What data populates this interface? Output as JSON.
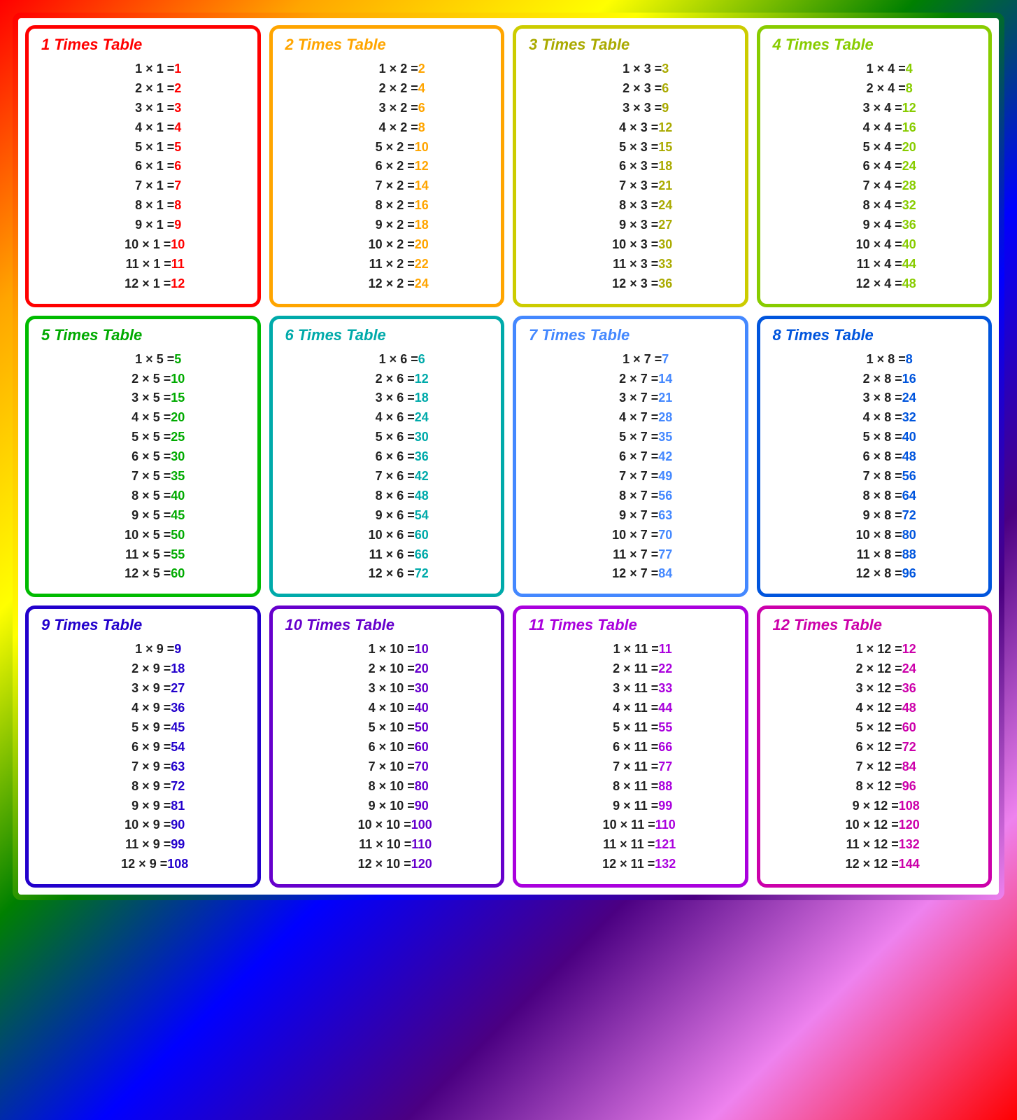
{
  "tables": [
    {
      "id": 1,
      "multiplier": 1,
      "title": "1 Times Table",
      "border": "red",
      "titleColor": "red",
      "resultColor": "red",
      "rows": [
        {
          "left": "1 × 1 =",
          "result": "1"
        },
        {
          "left": "2 × 1 =",
          "result": "2"
        },
        {
          "left": "3 × 1 =",
          "result": "3"
        },
        {
          "left": "4 × 1 =",
          "result": "4"
        },
        {
          "left": "5 × 1 =",
          "result": "5"
        },
        {
          "left": "6 × 1 =",
          "result": "6"
        },
        {
          "left": "7 × 1 =",
          "result": "7"
        },
        {
          "left": "8 × 1 =",
          "result": "8"
        },
        {
          "left": "9 × 1 =",
          "result": "9"
        },
        {
          "left": "10 × 1 =",
          "result": "10"
        },
        {
          "left": "11 × 1 =",
          "result": "11"
        },
        {
          "left": "12 × 1 =",
          "result": "12"
        }
      ]
    },
    {
      "id": 2,
      "multiplier": 2,
      "title": "2 Times Table",
      "border": "orange",
      "titleColor": "orange",
      "resultColor": "orange",
      "rows": [
        {
          "left": "1 × 2 =",
          "result": "2"
        },
        {
          "left": "2 × 2 =",
          "result": "4"
        },
        {
          "left": "3 × 2 =",
          "result": "6"
        },
        {
          "left": "4 × 2 =",
          "result": "8"
        },
        {
          "left": "5 × 2 =",
          "result": "10"
        },
        {
          "left": "6 × 2 =",
          "result": "12"
        },
        {
          "left": "7 × 2 =",
          "result": "14"
        },
        {
          "left": "8 × 2 =",
          "result": "16"
        },
        {
          "left": "9 × 2 =",
          "result": "18"
        },
        {
          "left": "10 × 2 =",
          "result": "20"
        },
        {
          "left": "11 × 2 =",
          "result": "22"
        },
        {
          "left": "12 × 2 =",
          "result": "24"
        }
      ]
    },
    {
      "id": 3,
      "multiplier": 3,
      "title": "3 Times Table",
      "border": "yellow",
      "titleColor": "yellow",
      "resultColor": "yellow",
      "rows": [
        {
          "left": "1 × 3 =",
          "result": "3"
        },
        {
          "left": "2 × 3 =",
          "result": "6"
        },
        {
          "left": "3 × 3 =",
          "result": "9"
        },
        {
          "left": "4 × 3 =",
          "result": "12"
        },
        {
          "left": "5 × 3 =",
          "result": "15"
        },
        {
          "left": "6 × 3 =",
          "result": "18"
        },
        {
          "left": "7 × 3 =",
          "result": "21"
        },
        {
          "left": "8 × 3 =",
          "result": "24"
        },
        {
          "left": "9 × 3 =",
          "result": "27"
        },
        {
          "left": "10 × 3 =",
          "result": "30"
        },
        {
          "left": "11 × 3 =",
          "result": "33"
        },
        {
          "left": "12 × 3 =",
          "result": "36"
        }
      ]
    },
    {
      "id": 4,
      "multiplier": 4,
      "title": "4 Times Table",
      "border": "green-light",
      "titleColor": "green-light",
      "resultColor": "green-light",
      "rows": [
        {
          "left": "1 × 4 =",
          "result": "4"
        },
        {
          "left": "2 × 4 =",
          "result": "8"
        },
        {
          "left": "3 × 4 =",
          "result": "12"
        },
        {
          "left": "4 × 4 =",
          "result": "16"
        },
        {
          "left": "5 × 4 =",
          "result": "20"
        },
        {
          "left": "6 × 4 =",
          "result": "24"
        },
        {
          "left": "7 × 4 =",
          "result": "28"
        },
        {
          "left": "8 × 4 =",
          "result": "32"
        },
        {
          "left": "9 × 4 =",
          "result": "36"
        },
        {
          "left": "10 × 4 =",
          "result": "40"
        },
        {
          "left": "11 × 4 =",
          "result": "44"
        },
        {
          "left": "12 × 4 =",
          "result": "48"
        }
      ]
    },
    {
      "id": 5,
      "multiplier": 5,
      "title": "5 Times Table",
      "border": "green",
      "titleColor": "green",
      "resultColor": "green",
      "rows": [
        {
          "left": "1 × 5 =",
          "result": "5"
        },
        {
          "left": "2 × 5 =",
          "result": "10"
        },
        {
          "left": "3 × 5 =",
          "result": "15"
        },
        {
          "left": "4 × 5 =",
          "result": "20"
        },
        {
          "left": "5 × 5 =",
          "result": "25"
        },
        {
          "left": "6 × 5 =",
          "result": "30"
        },
        {
          "left": "7 × 5 =",
          "result": "35"
        },
        {
          "left": "8 × 5 =",
          "result": "40"
        },
        {
          "left": "9 × 5 =",
          "result": "45"
        },
        {
          "left": "10 × 5 =",
          "result": "50"
        },
        {
          "left": "11 × 5 =",
          "result": "55"
        },
        {
          "left": "12 × 5 =",
          "result": "60"
        }
      ]
    },
    {
      "id": 6,
      "multiplier": 6,
      "title": "6 Times Table",
      "border": "teal",
      "titleColor": "teal",
      "resultColor": "teal",
      "rows": [
        {
          "left": "1 × 6 =",
          "result": "6"
        },
        {
          "left": "2 × 6 =",
          "result": "12"
        },
        {
          "left": "3 × 6 =",
          "result": "18"
        },
        {
          "left": "4 × 6 =",
          "result": "24"
        },
        {
          "left": "5 × 6 =",
          "result": "30"
        },
        {
          "left": "6 × 6 =",
          "result": "36"
        },
        {
          "left": "7 × 6 =",
          "result": "42"
        },
        {
          "left": "8 × 6 =",
          "result": "48"
        },
        {
          "left": "9 × 6 =",
          "result": "54"
        },
        {
          "left": "10 × 6 =",
          "result": "60"
        },
        {
          "left": "11 × 6 =",
          "result": "66"
        },
        {
          "left": "12 × 6 =",
          "result": "72"
        }
      ]
    },
    {
      "id": 7,
      "multiplier": 7,
      "title": "7 Times Table",
      "border": "blue-light",
      "titleColor": "blue-light",
      "resultColor": "blue-light",
      "rows": [
        {
          "left": "1 × 7 =",
          "result": "7"
        },
        {
          "left": "2 × 7 =",
          "result": "14"
        },
        {
          "left": "3 × 7 =",
          "result": "21"
        },
        {
          "left": "4 × 7 =",
          "result": "28"
        },
        {
          "left": "5 × 7 =",
          "result": "35"
        },
        {
          "left": "6 × 7 =",
          "result": "42"
        },
        {
          "left": "7 × 7 =",
          "result": "49"
        },
        {
          "left": "8 × 7 =",
          "result": "56"
        },
        {
          "left": "9 × 7 =",
          "result": "63"
        },
        {
          "left": "10 × 7 =",
          "result": "70"
        },
        {
          "left": "11 × 7 =",
          "result": "77"
        },
        {
          "left": "12 × 7 =",
          "result": "84"
        }
      ]
    },
    {
      "id": 8,
      "multiplier": 8,
      "title": "8 Times Table",
      "border": "blue",
      "titleColor": "blue",
      "resultColor": "blue",
      "rows": [
        {
          "left": "1 × 8 =",
          "result": "8"
        },
        {
          "left": "2 × 8 =",
          "result": "16"
        },
        {
          "left": "3 × 8 =",
          "result": "24"
        },
        {
          "left": "4 × 8 =",
          "result": "32"
        },
        {
          "left": "5 × 8 =",
          "result": "40"
        },
        {
          "left": "6 × 8 =",
          "result": "48"
        },
        {
          "left": "7 × 8 =",
          "result": "56"
        },
        {
          "left": "8 × 8 =",
          "result": "64"
        },
        {
          "left": "9 × 8 =",
          "result": "72"
        },
        {
          "left": "10 × 8 =",
          "result": "80"
        },
        {
          "left": "11 × 8 =",
          "result": "88"
        },
        {
          "left": "12 × 8 =",
          "result": "96"
        }
      ]
    },
    {
      "id": 9,
      "multiplier": 9,
      "title": "9 Times Table",
      "border": "blue-dark",
      "titleColor": "blue-dark",
      "resultColor": "blue-dark",
      "rows": [
        {
          "left": "1 × 9 =",
          "result": "9"
        },
        {
          "left": "2 × 9 =",
          "result": "18"
        },
        {
          "left": "3 × 9 =",
          "result": "27"
        },
        {
          "left": "4 × 9 =",
          "result": "36"
        },
        {
          "left": "5 × 9 =",
          "result": "45"
        },
        {
          "left": "6 × 9 =",
          "result": "54"
        },
        {
          "left": "7 × 9 =",
          "result": "63"
        },
        {
          "left": "8 × 9 =",
          "result": "72"
        },
        {
          "left": "9 × 9 =",
          "result": "81"
        },
        {
          "left": "10 × 9 =",
          "result": "90"
        },
        {
          "left": "11 × 9 =",
          "result": "99"
        },
        {
          "left": "12 × 9 =",
          "result": "108"
        }
      ]
    },
    {
      "id": 10,
      "multiplier": 10,
      "title": "10 Times Table",
      "border": "purple",
      "titleColor": "purple",
      "resultColor": "purple",
      "rows": [
        {
          "left": "1 × 10 =",
          "result": "10"
        },
        {
          "left": "2 × 10 =",
          "result": "20"
        },
        {
          "left": "3 × 10 =",
          "result": "30"
        },
        {
          "left": "4 × 10 =",
          "result": "40"
        },
        {
          "left": "5 × 10 =",
          "result": "50"
        },
        {
          "left": "6 × 10 =",
          "result": "60"
        },
        {
          "left": "7 × 10 =",
          "result": "70"
        },
        {
          "left": "8 × 10 =",
          "result": "80"
        },
        {
          "left": "9 × 10 =",
          "result": "90"
        },
        {
          "left": "10 × 10 =",
          "result": "100"
        },
        {
          "left": "11 × 10 =",
          "result": "110"
        },
        {
          "left": "12 × 10 =",
          "result": "120"
        }
      ]
    },
    {
      "id": 11,
      "multiplier": 11,
      "title": "11 Times Table",
      "border": "violet",
      "titleColor": "violet",
      "resultColor": "violet",
      "rows": [
        {
          "left": "1 × 11 =",
          "result": "11"
        },
        {
          "left": "2 × 11 =",
          "result": "22"
        },
        {
          "left": "3 × 11 =",
          "result": "33"
        },
        {
          "left": "4 × 11 =",
          "result": "44"
        },
        {
          "left": "5 × 11 =",
          "result": "55"
        },
        {
          "left": "6 × 11 =",
          "result": "66"
        },
        {
          "left": "7 × 11 =",
          "result": "77"
        },
        {
          "left": "8 × 11 =",
          "result": "88"
        },
        {
          "left": "9 × 11 =",
          "result": "99"
        },
        {
          "left": "10 × 11 =",
          "result": "110"
        },
        {
          "left": "11 × 11 =",
          "result": "121"
        },
        {
          "left": "12 × 11 =",
          "result": "132"
        }
      ]
    },
    {
      "id": 12,
      "multiplier": 12,
      "title": "12 Times Table",
      "border": "magenta",
      "titleColor": "magenta",
      "resultColor": "magenta",
      "rows": [
        {
          "left": "1 × 12 =",
          "result": "12"
        },
        {
          "left": "2 × 12 =",
          "result": "24"
        },
        {
          "left": "3 × 12 =",
          "result": "36"
        },
        {
          "left": "4 × 12 =",
          "result": "48"
        },
        {
          "left": "5 × 12 =",
          "result": "60"
        },
        {
          "left": "6 × 12 =",
          "result": "72"
        },
        {
          "left": "7 × 12 =",
          "result": "84"
        },
        {
          "left": "8 × 12 =",
          "result": "96"
        },
        {
          "left": "9 × 12 =",
          "result": "108"
        },
        {
          "left": "10 × 12 =",
          "result": "120"
        },
        {
          "left": "11 × 12 =",
          "result": "132"
        },
        {
          "left": "12 × 12 =",
          "result": "144"
        }
      ]
    }
  ]
}
